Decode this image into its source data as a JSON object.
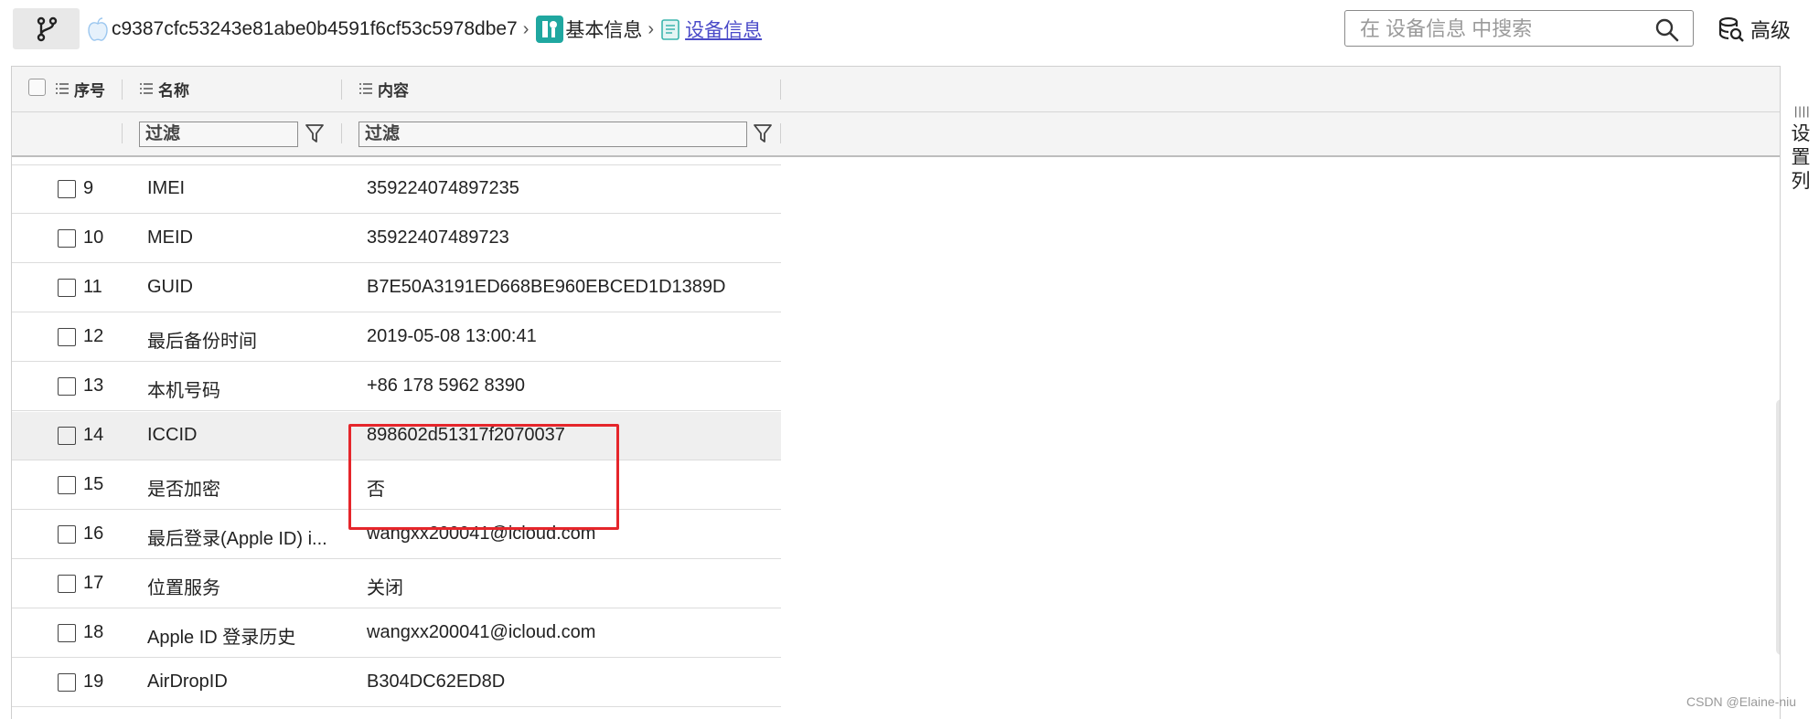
{
  "breadcrumb": {
    "device_id": "c9387cfc53243e81abe0b4591f6cf53c5978dbe7",
    "section": "基本信息",
    "current": "设备信息"
  },
  "search": {
    "placeholder": "在 设备信息 中搜索"
  },
  "advanced_label": "高级",
  "columns": {
    "index": "序号",
    "name": "名称",
    "content": "内容"
  },
  "filter": {
    "name_placeholder": "过滤",
    "content_placeholder": "过滤"
  },
  "rows": [
    {
      "index": "9",
      "name": "IMEI",
      "value": "359224074897235"
    },
    {
      "index": "10",
      "name": "MEID",
      "value": "35922407489723"
    },
    {
      "index": "11",
      "name": "GUID",
      "value": "B7E50A3191ED668BE960EBCED1D1389D"
    },
    {
      "index": "12",
      "name": "最后备份时间",
      "value": "2019-05-08 13:00:41"
    },
    {
      "index": "13",
      "name": "本机号码",
      "value": "+86 178 5962 8390"
    },
    {
      "index": "14",
      "name": "ICCID",
      "value": "898602d51317f2070037"
    },
    {
      "index": "15",
      "name": "是否加密",
      "value": "否"
    },
    {
      "index": "16",
      "name": "最后登录(Apple ID) i...",
      "value": "wangxx200041@icloud.com"
    },
    {
      "index": "17",
      "name": "位置服务",
      "value": "关闭"
    },
    {
      "index": "18",
      "name": "Apple ID 登录历史",
      "value": "wangxx200041@icloud.com"
    },
    {
      "index": "19",
      "name": "AirDropID",
      "value": "B304DC62ED8D"
    }
  ],
  "side_panel": {
    "label": "设置列"
  },
  "watermark": "CSDN @Elaine-niu",
  "colors": {
    "highlight": "#e5262b",
    "link": "#4a4ac8",
    "teal_icon": "#1fa7a0"
  }
}
